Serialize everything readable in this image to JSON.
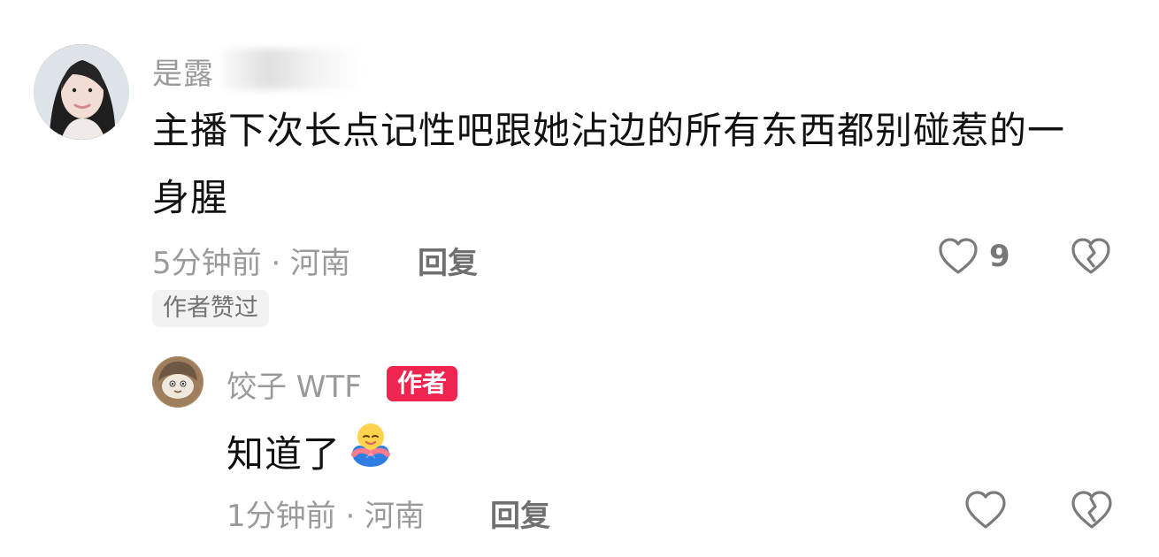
{
  "comment": {
    "username": "是露",
    "text": "主播下次长点记性吧跟她沾边的所有东西都别碰惹的一身腥",
    "time_location": "5分钟前 · 河南",
    "reply_label": "回复",
    "like_count": "9",
    "badge": "作者赞过",
    "icons": {
      "avatar": "avatar-icon",
      "like": "heart-icon",
      "dislike": "broken-heart-icon"
    }
  },
  "reply": {
    "username": "饺子 WTF",
    "author_badge": "作者",
    "text": "知道了",
    "emoji": "hug-emoji",
    "time_location": "1分钟前 · 河南",
    "reply_label": "回复",
    "icons": {
      "avatar": "avatar-icon",
      "like": "heart-icon",
      "dislike": "broken-heart-icon"
    }
  },
  "colors": {
    "author_badge": "#f0254f",
    "meta_text": "#9a9a9a",
    "comment_text": "#111111"
  }
}
